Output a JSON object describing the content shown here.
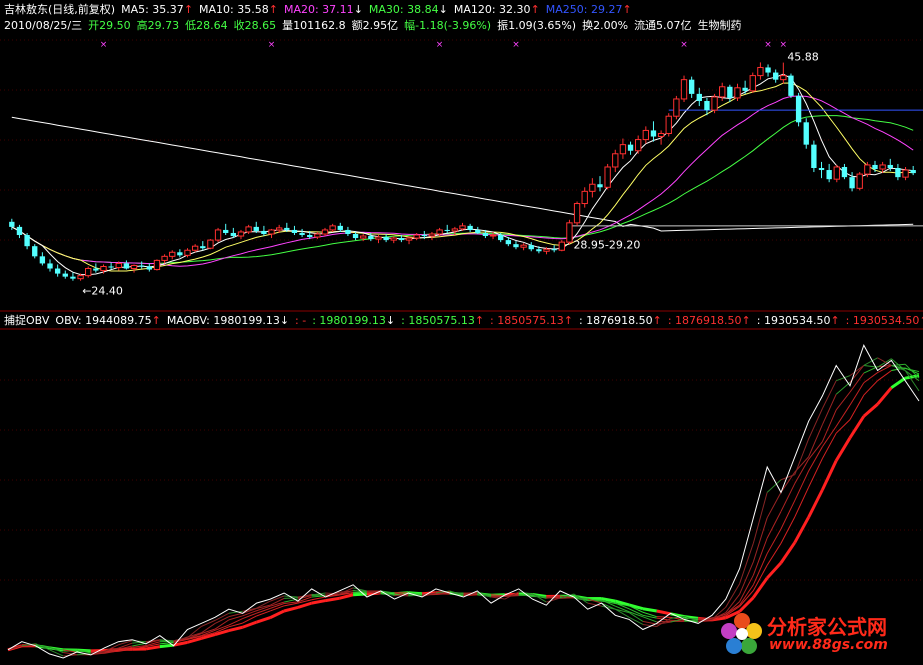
{
  "colors": {
    "background": "#000000",
    "grid": "#8a0000",
    "candle_up": "#ff3030",
    "candle_down": "#54ffff",
    "ma5": "#ffffff",
    "ma10": "#ffff66",
    "ma20": "#ff44ff",
    "ma30": "#44ff44",
    "ma120": "#ffffff",
    "ma250": "#3355ff",
    "obv": "#ffffff",
    "maobv_high": "#ff2020",
    "maobv_low": "#30ff30"
  },
  "header": {
    "line1": [
      {
        "text": "吉林敖东(日线,前复权)",
        "color": "#ffffff"
      },
      {
        "text": "MA5: 35.37",
        "arrow": "↑",
        "color": "#ffffff"
      },
      {
        "text": "MA10: 35.58",
        "arrow": "↑",
        "color": "#ffffff"
      },
      {
        "text": "MA20: 37.11",
        "arrow": "↓",
        "color": "#ff44ff"
      },
      {
        "text": "MA30: 38.84",
        "arrow": "↓",
        "color": "#44ff44"
      },
      {
        "text": "MA120: 32.30",
        "arrow": "↑",
        "color": "#ffffff"
      },
      {
        "text": "MA250: 29.27",
        "arrow": "↑",
        "color": "#3355ff"
      }
    ],
    "line2": [
      {
        "text": "2010/08/25/三",
        "color": "#ffffff"
      },
      {
        "text": "开29.50",
        "color": "#44ff44"
      },
      {
        "text": "高29.73",
        "color": "#44ff44"
      },
      {
        "text": "低28.64",
        "color": "#44ff44"
      },
      {
        "text": "收28.65",
        "color": "#44ff44"
      },
      {
        "text": "量101162.8",
        "color": "#ffffff"
      },
      {
        "text": "额2.95亿",
        "color": "#ffffff"
      },
      {
        "text": "幅-1.18(-3.96%)",
        "color": "#44ff44"
      },
      {
        "text": "振1.09(3.65%)",
        "color": "#ffffff"
      },
      {
        "text": "换2.00%",
        "color": "#ffffff"
      },
      {
        "text": "流通5.07亿",
        "color": "#ffffff"
      },
      {
        "text": "生物制药",
        "color": "#ffffff"
      }
    ]
  },
  "obv_header": [
    {
      "text": "捕捉OBV",
      "color": "#ffffff"
    },
    {
      "text": "OBV: 1944089.75",
      "arrow": "↑",
      "color": "#ffffff"
    },
    {
      "text": "MAOBV: 1980199.13",
      "arrow": "↓",
      "color": "#ffffff"
    },
    {
      "text": ": -",
      "color": "#ff3030"
    },
    {
      "text": ": 1980199.13",
      "arrow": "↓",
      "color": "#44ff44"
    },
    {
      "text": ": 1850575.13",
      "arrow": "↑",
      "color": "#44ff44"
    },
    {
      "text": ": 1850575.13",
      "arrow": "↑",
      "color": "#ff3030"
    },
    {
      "text": ": 1876918.50",
      "arrow": "↑",
      "color": "#ffffff"
    },
    {
      "text": ": 1876918.50",
      "arrow": "↑",
      "color": "#ff3030"
    },
    {
      "text": ": 1930534.50",
      "arrow": "↑",
      "color": "#ffffff"
    },
    {
      "text": ": 1930534.50",
      "arrow": "↑",
      "color": "#ff3030"
    }
  ],
  "watermark": {
    "title": "分析家公式网",
    "url": "www.88gs.com"
  },
  "chart_data": [
    {
      "type": "candlestick",
      "annotations": [
        {
          "text": "←24.40",
          "index": 10,
          "price": 24.4
        },
        {
          "text": "28.95-29.20",
          "index": 73,
          "price": 28.95
        },
        {
          "text": "45.88",
          "index": 101,
          "price": 45.88
        }
      ],
      "ylim": [
        22.5,
        48.5
      ],
      "ohlc": [
        [
          30.2,
          30.5,
          29.4,
          29.7
        ],
        [
          29.7,
          29.9,
          28.6,
          28.9
        ],
        [
          28.9,
          29.1,
          27.5,
          27.8
        ],
        [
          27.8,
          28.0,
          26.6,
          26.8
        ],
        [
          26.8,
          27.2,
          25.9,
          26.1
        ],
        [
          26.1,
          26.5,
          25.3,
          25.6
        ],
        [
          25.6,
          26.0,
          24.8,
          25.1
        ],
        [
          25.1,
          25.4,
          24.6,
          24.8
        ],
        [
          24.8,
          25.2,
          24.4,
          24.6
        ],
        [
          24.6,
          25.1,
          24.4,
          24.9
        ],
        [
          24.9,
          25.8,
          24.7,
          25.6
        ],
        [
          25.6,
          26.1,
          25.2,
          25.4
        ],
        [
          25.4,
          26.0,
          25.1,
          25.8
        ],
        [
          25.8,
          26.2,
          25.5,
          25.7
        ],
        [
          25.7,
          26.3,
          25.4,
          26.1
        ],
        [
          26.1,
          26.4,
          25.5,
          25.6
        ],
        [
          25.6,
          26.0,
          25.2,
          25.9
        ],
        [
          25.9,
          26.3,
          25.6,
          25.8
        ],
        [
          25.8,
          26.1,
          25.3,
          25.5
        ],
        [
          25.5,
          26.5,
          25.4,
          26.4
        ],
        [
          26.4,
          27.0,
          26.1,
          26.8
        ],
        [
          26.8,
          27.4,
          26.5,
          27.2
        ],
        [
          27.2,
          27.5,
          26.7,
          26.9
        ],
        [
          26.9,
          27.6,
          26.7,
          27.4
        ],
        [
          27.4,
          28.0,
          27.2,
          27.8
        ],
        [
          27.8,
          28.3,
          27.4,
          27.6
        ],
        [
          27.6,
          28.5,
          27.5,
          28.4
        ],
        [
          28.4,
          29.6,
          28.2,
          29.4
        ],
        [
          29.4,
          30.0,
          28.9,
          29.1
        ],
        [
          29.1,
          29.6,
          28.6,
          28.8
        ],
        [
          28.8,
          29.4,
          28.5,
          29.2
        ],
        [
          29.2,
          29.9,
          29.0,
          29.7
        ],
        [
          29.7,
          30.2,
          29.1,
          29.3
        ],
        [
          29.3,
          29.8,
          28.8,
          29.0
        ],
        [
          29.0,
          29.5,
          28.6,
          29.4
        ],
        [
          29.4,
          29.9,
          29.1,
          29.6
        ],
        [
          29.6,
          30.1,
          29.2,
          29.4
        ],
        [
          29.4,
          29.8,
          28.9,
          29.1
        ],
        [
          29.1,
          29.5,
          28.7,
          28.9
        ],
        [
          28.9,
          29.3,
          28.5,
          28.7
        ],
        [
          28.7,
          29.2,
          28.5,
          29.0
        ],
        [
          29.0,
          29.6,
          28.8,
          29.4
        ],
        [
          29.4,
          30.0,
          29.2,
          29.8
        ],
        [
          29.8,
          30.1,
          29.2,
          29.4
        ],
        [
          29.4,
          29.7,
          28.8,
          29.0
        ],
        [
          29.0,
          29.2,
          28.4,
          28.6
        ],
        [
          28.6,
          29.0,
          28.3,
          28.8
        ],
        [
          28.8,
          29.1,
          28.3,
          28.5
        ],
        [
          28.5,
          28.9,
          28.1,
          28.7
        ],
        [
          28.7,
          29.0,
          28.2,
          28.4
        ],
        [
          28.4,
          28.8,
          28.1,
          28.6
        ],
        [
          28.6,
          28.9,
          28.2,
          28.4
        ],
        [
          28.4,
          28.8,
          28.0,
          28.6
        ],
        [
          28.6,
          29.1,
          28.4,
          28.9
        ],
        [
          28.9,
          29.3,
          28.5,
          28.8
        ],
        [
          28.8,
          29.2,
          28.4,
          29.0
        ],
        [
          29.0,
          29.6,
          28.8,
          29.4
        ],
        [
          29.4,
          29.9,
          29.1,
          29.3
        ],
        [
          29.3,
          29.7,
          28.9,
          29.5
        ],
        [
          29.5,
          30.1,
          29.3,
          29.8
        ],
        [
          29.8,
          30.0,
          29.2,
          29.4
        ],
        [
          29.4,
          29.7,
          29.0,
          29.1
        ],
        [
          29.1,
          29.4,
          28.6,
          28.8
        ],
        [
          28.8,
          29.2,
          28.5,
          28.9
        ],
        [
          28.9,
          29.1,
          28.2,
          28.4
        ],
        [
          28.4,
          28.7,
          27.8,
          28.0
        ],
        [
          28.0,
          28.3,
          27.5,
          27.7
        ],
        [
          27.7,
          28.1,
          27.4,
          27.9
        ],
        [
          27.9,
          28.2,
          27.3,
          27.5
        ],
        [
          27.5,
          27.8,
          27.1,
          27.3
        ],
        [
          27.3,
          27.7,
          27.0,
          27.5
        ],
        [
          27.5,
          27.9,
          27.2,
          27.4
        ],
        [
          27.4,
          28.4,
          27.3,
          28.2
        ],
        [
          28.2,
          30.4,
          28.0,
          30.1
        ],
        [
          30.1,
          32.2,
          29.8,
          32.0
        ],
        [
          32.0,
          33.6,
          31.6,
          33.2
        ],
        [
          33.2,
          34.5,
          32.6,
          33.9
        ],
        [
          33.9,
          34.7,
          33.2,
          33.6
        ],
        [
          33.6,
          35.9,
          33.4,
          35.6
        ],
        [
          35.6,
          37.3,
          35.1,
          36.9
        ],
        [
          36.9,
          38.4,
          36.4,
          37.8
        ],
        [
          37.8,
          38.1,
          36.8,
          37.2
        ],
        [
          37.2,
          38.7,
          36.9,
          38.3
        ],
        [
          38.3,
          39.6,
          37.9,
          39.2
        ],
        [
          39.2,
          40.1,
          38.1,
          38.6
        ],
        [
          38.6,
          39.2,
          37.8,
          38.9
        ],
        [
          38.9,
          40.9,
          38.6,
          40.6
        ],
        [
          40.6,
          42.6,
          40.3,
          42.3
        ],
        [
          42.3,
          44.6,
          42.0,
          44.2
        ],
        [
          44.2,
          44.5,
          42.4,
          42.8
        ],
        [
          42.8,
          43.4,
          41.6,
          42.1
        ],
        [
          42.1,
          42.4,
          40.7,
          41.2
        ],
        [
          41.2,
          42.8,
          40.9,
          42.5
        ],
        [
          42.5,
          43.9,
          42.1,
          43.5
        ],
        [
          43.5,
          43.7,
          42.0,
          42.4
        ],
        [
          42.4,
          43.8,
          42.1,
          43.4
        ],
        [
          43.4,
          44.1,
          42.8,
          43.1
        ],
        [
          43.1,
          44.9,
          42.9,
          44.6
        ],
        [
          44.6,
          45.9,
          44.2,
          45.4
        ],
        [
          45.4,
          45.7,
          44.5,
          44.9
        ],
        [
          44.9,
          45.2,
          43.9,
          44.2
        ],
        [
          44.2,
          45.88,
          43.8,
          44.6
        ],
        [
          44.6,
          44.8,
          42.4,
          42.6
        ],
        [
          42.6,
          42.9,
          39.6,
          40.0
        ],
        [
          40.0,
          40.4,
          37.4,
          37.8
        ],
        [
          37.8,
          38.2,
          35.1,
          35.5
        ],
        [
          35.5,
          36.1,
          34.5,
          35.3
        ],
        [
          35.3,
          35.9,
          34.1,
          34.4
        ],
        [
          34.4,
          35.8,
          34.1,
          35.6
        ],
        [
          35.6,
          35.9,
          34.4,
          34.6
        ],
        [
          34.6,
          35.1,
          33.2,
          33.5
        ],
        [
          33.5,
          35.1,
          33.3,
          34.9
        ],
        [
          34.9,
          36.1,
          34.6,
          35.8
        ],
        [
          35.8,
          36.2,
          35.1,
          35.4
        ],
        [
          35.4,
          36.1,
          35.0,
          35.8
        ],
        [
          35.8,
          36.4,
          35.2,
          35.5
        ],
        [
          35.5,
          35.9,
          34.3,
          34.6
        ],
        [
          34.6,
          35.6,
          34.3,
          35.3
        ],
        [
          35.3,
          35.7,
          34.8,
          35.0
        ]
      ]
    },
    {
      "type": "line",
      "series": [
        {
          "name": "OBV",
          "values": [
            10,
            18,
            14,
            6,
            2,
            8,
            5,
            12,
            18,
            20,
            16,
            24,
            14,
            30,
            36,
            42,
            50,
            46,
            56,
            60,
            66,
            58,
            70,
            62,
            68,
            74,
            62,
            68,
            60,
            66,
            62,
            70,
            66,
            62,
            68,
            56,
            64,
            70,
            60,
            54,
            68,
            62,
            50,
            56,
            44,
            40,
            30,
            36,
            46,
            40,
            36,
            44,
            60,
            90,
            140,
            190,
            165,
            200,
            235,
            260,
            290,
            270,
            310,
            285,
            295,
            275,
            255
          ]
        }
      ],
      "ylim": [
        0,
        320
      ]
    }
  ]
}
